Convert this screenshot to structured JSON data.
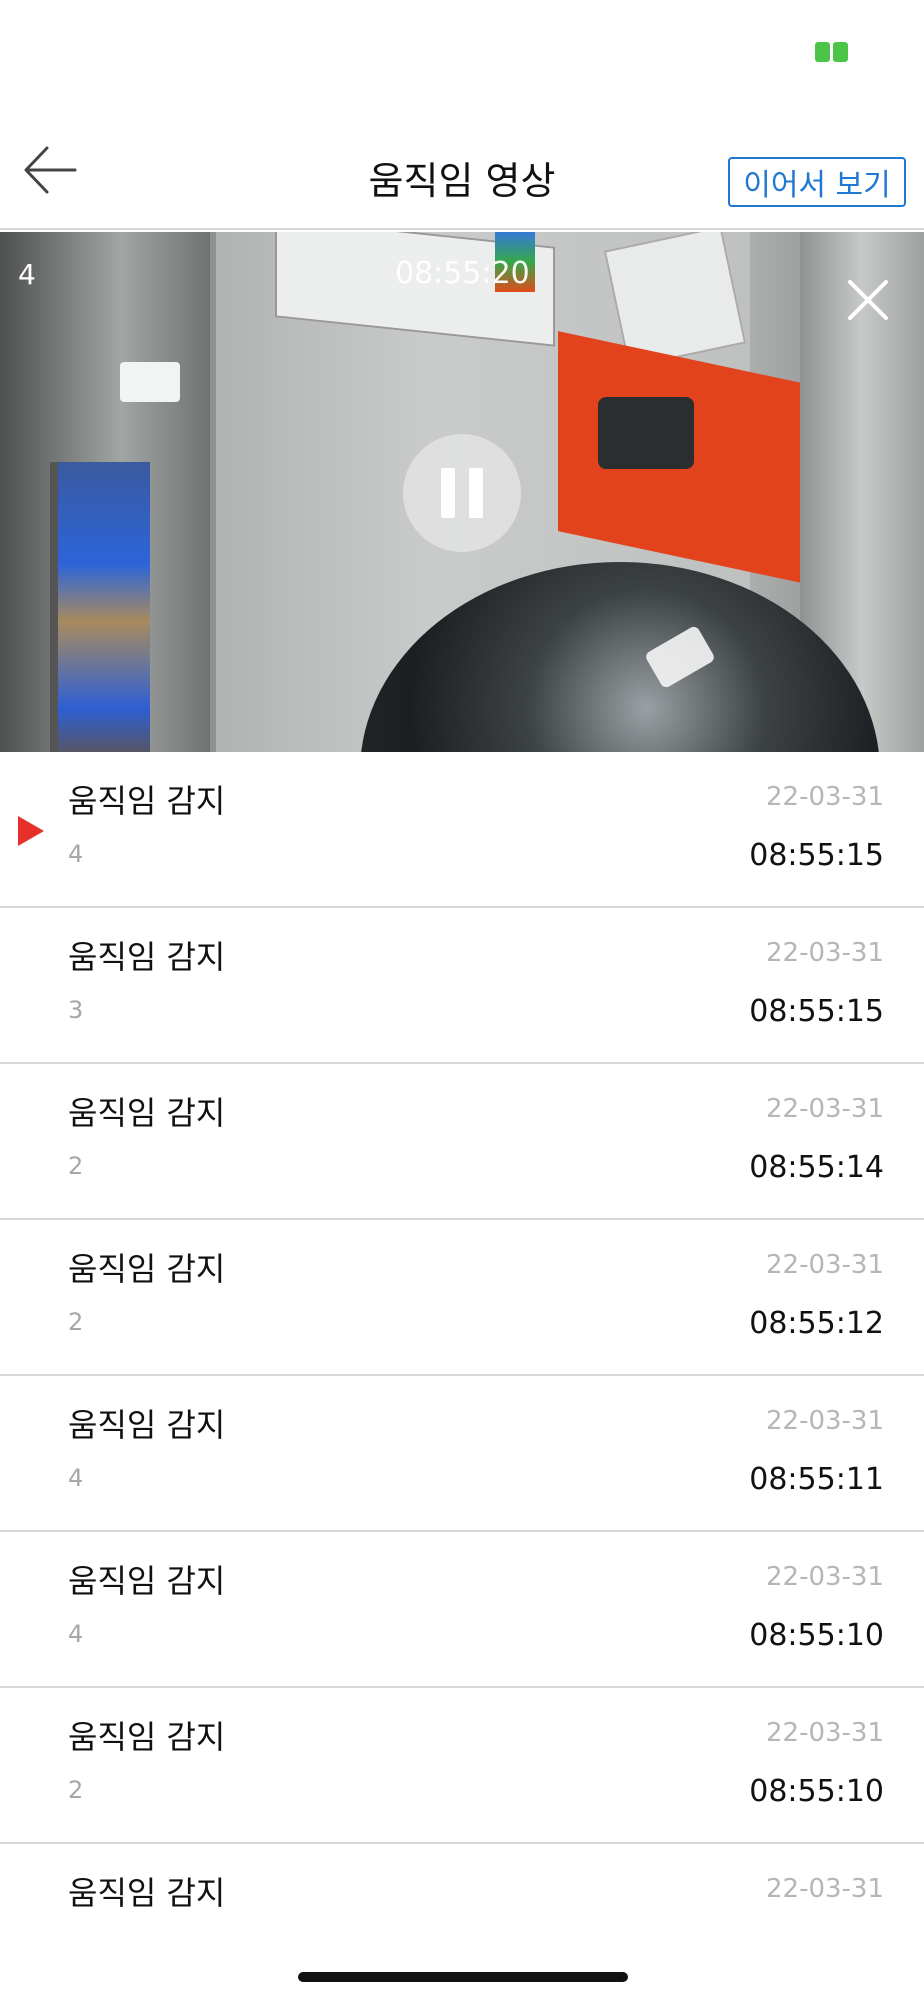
{
  "header": {
    "title": "움직임 영상",
    "continue_label": "이어서 보기"
  },
  "video": {
    "channel": "4",
    "timestamp": "08:55:20"
  },
  "events": [
    {
      "title": "움직임 감지",
      "channel": "4",
      "date": "22-03-31",
      "time": "08:55:15",
      "playing": true
    },
    {
      "title": "움직임 감지",
      "channel": "3",
      "date": "22-03-31",
      "time": "08:55:15",
      "playing": false
    },
    {
      "title": "움직임 감지",
      "channel": "2",
      "date": "22-03-31",
      "time": "08:55:14",
      "playing": false
    },
    {
      "title": "움직임 감지",
      "channel": "2",
      "date": "22-03-31",
      "time": "08:55:12",
      "playing": false
    },
    {
      "title": "움직임 감지",
      "channel": "4",
      "date": "22-03-31",
      "time": "08:55:11",
      "playing": false
    },
    {
      "title": "움직임 감지",
      "channel": "4",
      "date": "22-03-31",
      "time": "08:55:10",
      "playing": false
    },
    {
      "title": "움직임 감지",
      "channel": "2",
      "date": "22-03-31",
      "time": "08:55:10",
      "playing": false
    },
    {
      "title": "움직임 감지",
      "channel": "",
      "date": "22-03-31",
      "time": "",
      "playing": false
    }
  ],
  "colors": {
    "accent": "#1f78d1",
    "playing_indicator": "#e8302a",
    "status_indicator": "#4cc44a"
  }
}
